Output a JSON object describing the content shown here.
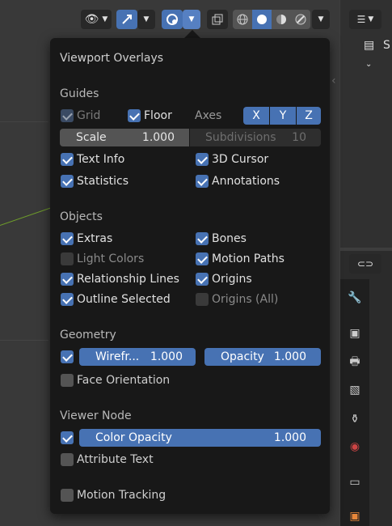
{
  "popup": {
    "title": "Viewport Overlays",
    "guides": {
      "heading": "Guides",
      "grid": {
        "label": "Grid",
        "checked": true,
        "enabled": false
      },
      "floor": {
        "label": "Floor",
        "checked": true
      },
      "axes_label": "Axes",
      "axes": [
        "X",
        "Y",
        "Z"
      ],
      "scale": {
        "label": "Scale",
        "value": "1.000"
      },
      "subdivisions": {
        "label": "Subdivisions",
        "value": "10"
      },
      "text_info": {
        "label": "Text Info",
        "checked": true
      },
      "cursor_3d": {
        "label": "3D Cursor",
        "checked": true
      },
      "statistics": {
        "label": "Statistics",
        "checked": true
      },
      "annotations": {
        "label": "Annotations",
        "checked": true
      }
    },
    "objects": {
      "heading": "Objects",
      "extras": {
        "label": "Extras",
        "checked": true
      },
      "bones": {
        "label": "Bones",
        "checked": true
      },
      "light_colors": {
        "label": "Light Colors",
        "checked": false
      },
      "motion_paths": {
        "label": "Motion Paths",
        "checked": true
      },
      "relationship_lines": {
        "label": "Relationship Lines",
        "checked": true
      },
      "origins": {
        "label": "Origins",
        "checked": true
      },
      "outline_selected": {
        "label": "Outline Selected",
        "checked": true
      },
      "origins_all": {
        "label": "Origins (All)",
        "checked": false
      }
    },
    "geometry": {
      "heading": "Geometry",
      "wireframe": {
        "label": "Wirefr...",
        "value": "1.000",
        "checked": true
      },
      "opacity": {
        "label": "Opacity",
        "value": "1.000"
      },
      "face_orientation": {
        "label": "Face Orientation",
        "checked": false
      }
    },
    "viewer_node": {
      "heading": "Viewer Node",
      "color_opacity": {
        "label": "Color Opacity",
        "value": "1.000",
        "checked": true
      },
      "attribute_text": {
        "label": "Attribute Text",
        "checked": false
      }
    },
    "motion_tracking": {
      "label": "Motion Tracking",
      "checked": false
    }
  },
  "header": {
    "icons": [
      "visibility-icon",
      "gizmo-icon",
      "overlays-icon",
      "xray-icon",
      "wireframe-shading-icon",
      "solid-shading-icon",
      "material-shading-icon",
      "rendered-shading-icon"
    ]
  },
  "outliner": {
    "partial_text": "S"
  },
  "colors": {
    "accent": "#4772b3",
    "popup_bg": "#181818",
    "field_grey": "#545454"
  }
}
